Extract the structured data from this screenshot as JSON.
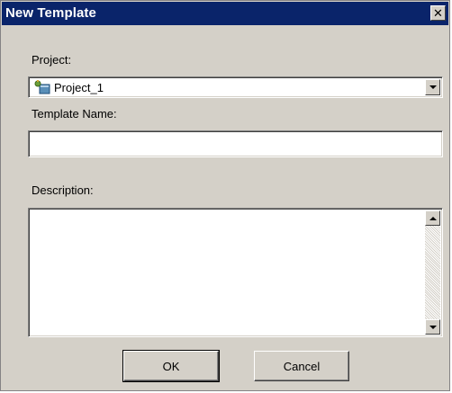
{
  "window": {
    "title": "New Template",
    "close_glyph": "✕"
  },
  "project": {
    "label": "Project:",
    "selected": "Project_1",
    "icon": "project-icon"
  },
  "template_name": {
    "label": "Template Name:",
    "value": "",
    "placeholder": ""
  },
  "description": {
    "label": "Description:",
    "value": ""
  },
  "buttons": {
    "ok": "OK",
    "cancel": "Cancel"
  },
  "colors": {
    "titlebar": "#0a246a",
    "dialog_bg": "#d4d0c8"
  }
}
